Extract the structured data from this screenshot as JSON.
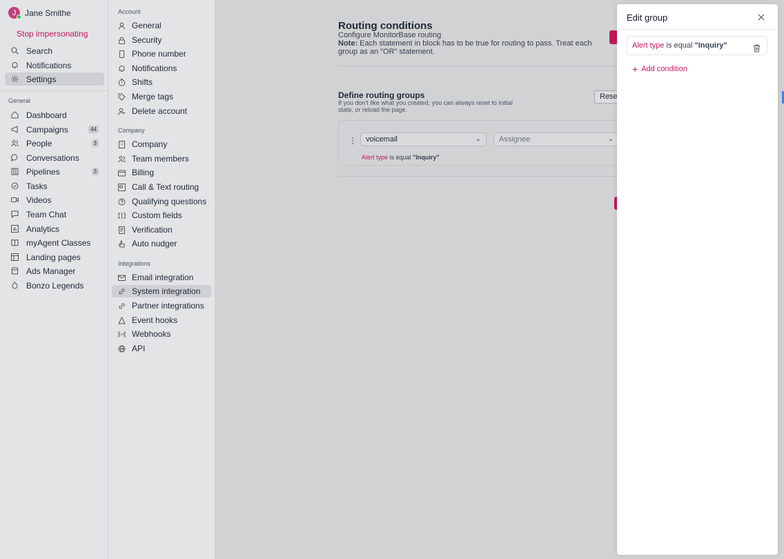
{
  "user": {
    "initial": "J",
    "name": "Jane Smithe",
    "stop_label": "Stop impersonating"
  },
  "nav_top": [
    {
      "label": "Search",
      "icon": "search-icon"
    },
    {
      "label": "Notifications",
      "icon": "bell-icon"
    },
    {
      "label": "Settings",
      "icon": "gear-icon"
    }
  ],
  "nav_general_heading": "General",
  "nav_general": [
    {
      "label": "Dashboard",
      "icon": "home-icon",
      "badge": ""
    },
    {
      "label": "Campaigns",
      "icon": "megaphone-icon",
      "badge": "44"
    },
    {
      "label": "People",
      "icon": "people-icon",
      "badge": "3"
    },
    {
      "label": "Conversations",
      "icon": "chat-icon",
      "badge": ""
    },
    {
      "label": "Pipelines",
      "icon": "columns-icon",
      "badge": "3"
    },
    {
      "label": "Tasks",
      "icon": "check-circle-icon",
      "badge": ""
    },
    {
      "label": "Videos",
      "icon": "video-icon",
      "badge": ""
    },
    {
      "label": "Team Chat",
      "icon": "message-icon",
      "badge": ""
    },
    {
      "label": "Analytics",
      "icon": "chart-icon",
      "badge": ""
    },
    {
      "label": "myAgent Classes",
      "icon": "book-icon",
      "badge": ""
    },
    {
      "label": "Landing pages",
      "icon": "layout-icon",
      "badge": ""
    },
    {
      "label": "Ads Manager",
      "icon": "store-icon",
      "badge": ""
    },
    {
      "label": "Bonzo Legends",
      "icon": "flame-icon",
      "badge": ""
    }
  ],
  "settings": {
    "account_heading": "Account",
    "account": [
      {
        "label": "General",
        "icon": "user-icon"
      },
      {
        "label": "Security",
        "icon": "lock-icon"
      },
      {
        "label": "Phone number",
        "icon": "phone-icon"
      },
      {
        "label": "Notifications",
        "icon": "bell-icon"
      },
      {
        "label": "Shifts",
        "icon": "timer-icon"
      },
      {
        "label": "Merge tags",
        "icon": "tag-icon"
      },
      {
        "label": "Delete account",
        "icon": "user-remove-icon"
      }
    ],
    "company_heading": "Company",
    "company": [
      {
        "label": "Company",
        "icon": "building-icon"
      },
      {
        "label": "Team members",
        "icon": "people-icon"
      },
      {
        "label": "Billing",
        "icon": "wallet-icon"
      },
      {
        "label": "Call & Text routing",
        "icon": "routing-icon"
      },
      {
        "label": "Qualifying questions",
        "icon": "question-icon"
      },
      {
        "label": "Custom fields",
        "icon": "fields-icon"
      },
      {
        "label": "Verification",
        "icon": "document-check-icon"
      },
      {
        "label": "Auto nudger",
        "icon": "hand-icon"
      }
    ],
    "integrations_heading": "Integrations",
    "integrations": [
      {
        "label": "Email integration",
        "icon": "mail-icon"
      },
      {
        "label": "System integration",
        "icon": "link-icon"
      },
      {
        "label": "Partner integrations",
        "icon": "chain-icon"
      },
      {
        "label": "Event hooks",
        "icon": "triangle-icon"
      },
      {
        "label": "Webhooks",
        "icon": "broadcast-icon"
      },
      {
        "label": "API",
        "icon": "globe-icon"
      }
    ]
  },
  "routing": {
    "title": "Routing conditions",
    "subtitle": "Configure MonitorBase routing",
    "note_label": "Note:",
    "note_text": " Each statement in block has to be true for routing to pass. Treat each group as an \"OR\" statement.",
    "groups_title": "Define routing groups",
    "groups_desc": "If you don't like what you created, you can always reset to initial state, or reload the page.",
    "reset_label": "Reset",
    "group": {
      "source_value": "voicemail",
      "assignee_placeholder": "Assignee",
      "cond_field": "Alert type",
      "cond_op": " is equal ",
      "cond_value": "\"Inquiry\""
    }
  },
  "drawer": {
    "title": "Edit group",
    "condition": {
      "field": "Alert type",
      "op": " is equal ",
      "value": "\"Inquiry\""
    },
    "add_label": "Add condition"
  },
  "colors": {
    "accent": "#c2185b",
    "panel": "#ffffff",
    "overlay_bg": "#d1d2d4"
  }
}
